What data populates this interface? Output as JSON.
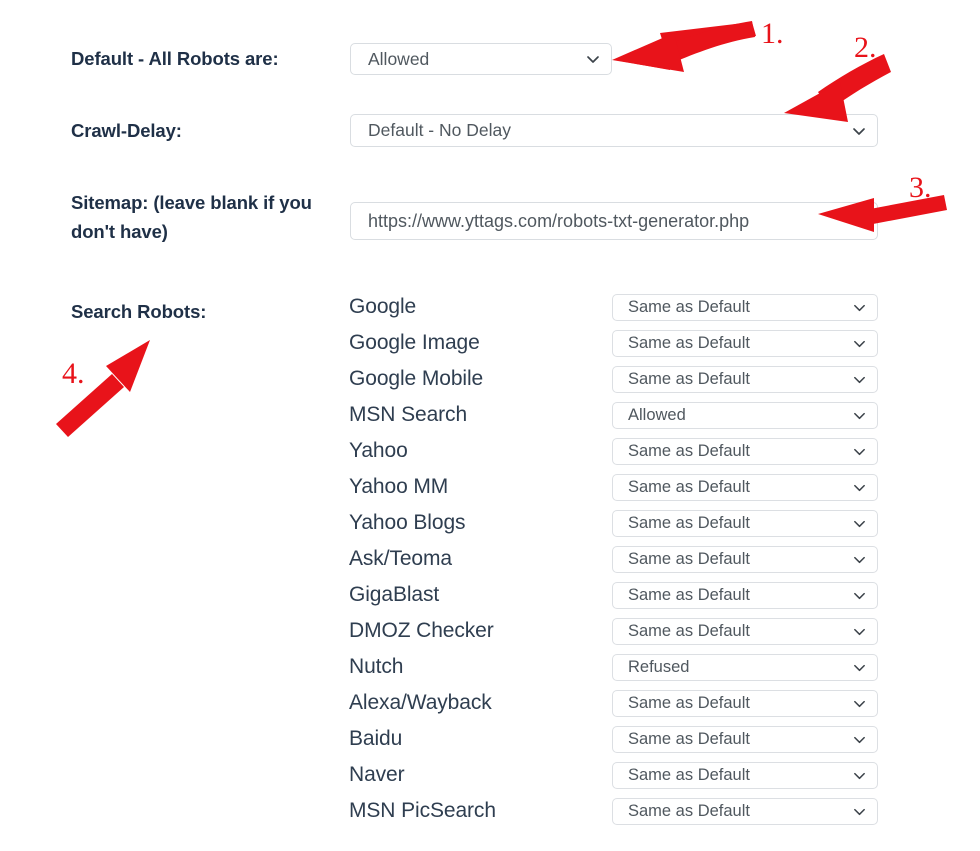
{
  "form": {
    "default_robots": {
      "label": "Default - All Robots are:",
      "value": "Allowed"
    },
    "crawl_delay": {
      "label": "Crawl-Delay:",
      "value": "Default - No Delay"
    },
    "sitemap": {
      "label": "Sitemap: (leave blank if you don't have)",
      "value": "https://www.yttags.com/robots-txt-generator.php",
      "placeholder": "https://www.yttags.com/robots-txt-generator.php"
    },
    "search_robots": {
      "label": "Search Robots:",
      "rows": [
        {
          "name": "Google",
          "value": "Same as Default"
        },
        {
          "name": "Google Image",
          "value": "Same as Default"
        },
        {
          "name": "Google Mobile",
          "value": "Same as Default"
        },
        {
          "name": "MSN Search",
          "value": "Allowed"
        },
        {
          "name": "Yahoo",
          "value": "Same as Default"
        },
        {
          "name": "Yahoo MM",
          "value": "Same as Default"
        },
        {
          "name": "Yahoo Blogs",
          "value": "Same as Default"
        },
        {
          "name": "Ask/Teoma",
          "value": "Same as Default"
        },
        {
          "name": "GigaBlast",
          "value": "Same as Default"
        },
        {
          "name": "DMOZ Checker",
          "value": "Same as Default"
        },
        {
          "name": "Nutch",
          "value": "Refused"
        },
        {
          "name": "Alexa/Wayback",
          "value": "Same as Default"
        },
        {
          "name": "Baidu",
          "value": "Same as Default"
        },
        {
          "name": "Naver",
          "value": "Same as Default"
        },
        {
          "name": "MSN PicSearch",
          "value": "Same as Default"
        }
      ]
    }
  },
  "annotations": {
    "color": "#e8131a",
    "items": [
      {
        "number": "1.",
        "points_to": "default-robots-select"
      },
      {
        "number": "2.",
        "points_to": "crawl-delay-select"
      },
      {
        "number": "3.",
        "points_to": "sitemap-input"
      },
      {
        "number": "4.",
        "points_to": "search-robots-label"
      }
    ]
  },
  "icons": {
    "chevron": "chevron-down-icon"
  },
  "colors": {
    "label_text": "#1f3047",
    "robot_name_text": "#2f3e50",
    "control_text": "#50585f",
    "control_border": "#d9dde1",
    "annotation_red": "#e8131a",
    "background": "#ffffff"
  }
}
